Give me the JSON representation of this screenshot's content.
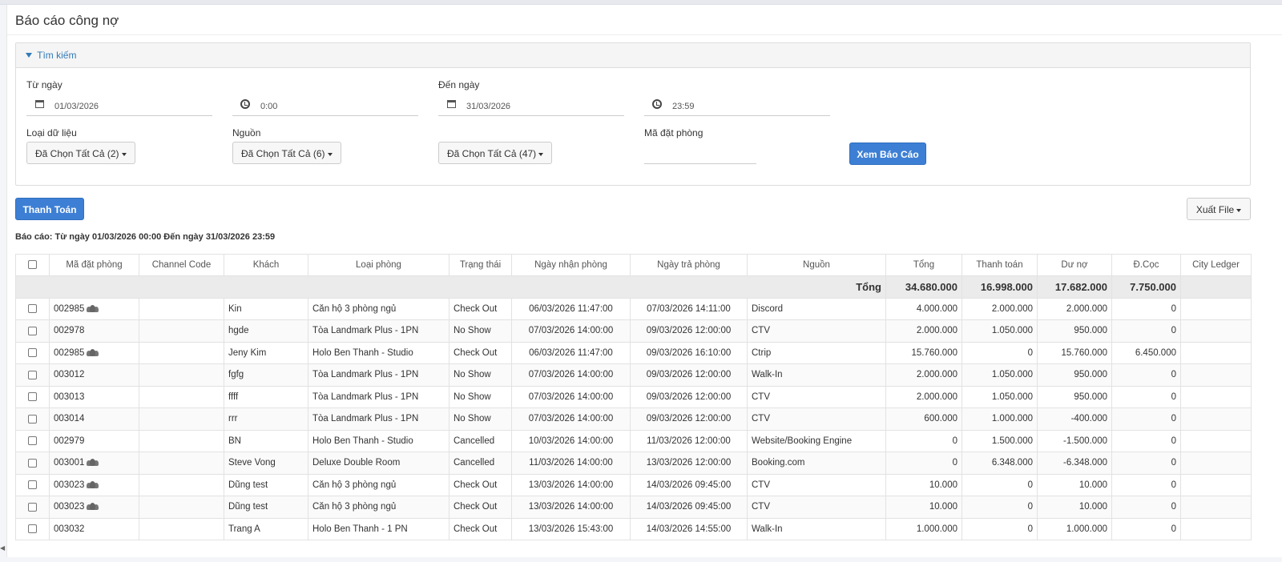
{
  "page": {
    "title": "Báo cáo công nợ"
  },
  "search": {
    "header": "Tìm kiếm",
    "from_label": "Từ ngày",
    "from_date": "01/03/2026",
    "from_time": "0:00",
    "to_label": "Đến ngày",
    "to_date": "31/03/2026",
    "to_time": "23:59",
    "data_type_label": "Loại dữ liệu",
    "data_type_value": "Đã Chọn Tất Cả (2)",
    "source_label": "Nguồn",
    "source_value": "Đã Chọn Tất Cả (6)",
    "third_value": "Đã Chọn Tất Cả (47)",
    "booking_code_label": "Mã đặt phòng",
    "booking_code_value": "",
    "view_button": "Xem Báo Cáo"
  },
  "toolbar": {
    "pay_button": "Thanh Toán",
    "export_button": "Xuất File"
  },
  "report_note": "Báo cáo: Từ ngày 01/03/2026 00:00 Đến ngày 31/03/2026 23:59",
  "table": {
    "headers": [
      "Mã đặt phòng",
      "Channel Code",
      "Khách",
      "Loại phòng",
      "Trạng thái",
      "Ngày nhận phòng",
      "Ngày trả phòng",
      "Nguồn",
      "Tổng",
      "Thanh toán",
      "Dư nợ",
      "Đ.Cọc",
      "City Ledger"
    ],
    "total": {
      "label": "Tổng",
      "tong": "34.680.000",
      "thanh_toan": "16.998.000",
      "du_no": "17.682.000",
      "coc": "7.750.000"
    },
    "rows": [
      {
        "code": "002985",
        "group": true,
        "channel": "",
        "guest": "Kin",
        "room": "Căn hộ 3 phòng ngủ",
        "status": "Check Out",
        "checkin": "06/03/2026 11:47:00",
        "checkout": "07/03/2026 14:11:00",
        "source": "Discord",
        "tong": "4.000.000",
        "paid": "2.000.000",
        "debt": "2.000.000",
        "deposit": "0",
        "ledger": ""
      },
      {
        "code": "002978",
        "group": false,
        "channel": "",
        "guest": "hgde",
        "room": "Tòa Landmark Plus - 1PN",
        "status": "No Show",
        "checkin": "07/03/2026 14:00:00",
        "checkout": "09/03/2026 12:00:00",
        "source": "CTV",
        "tong": "2.000.000",
        "paid": "1.050.000",
        "debt": "950.000",
        "deposit": "0",
        "ledger": ""
      },
      {
        "code": "002985",
        "group": true,
        "channel": "",
        "guest": "Jeny Kim",
        "room": "Holo Ben Thanh - Studio",
        "status": "Check Out",
        "checkin": "06/03/2026 11:47:00",
        "checkout": "09/03/2026 16:10:00",
        "source": "Ctrip",
        "tong": "15.760.000",
        "paid": "0",
        "debt": "15.760.000",
        "deposit": "6.450.000",
        "ledger": ""
      },
      {
        "code": "003012",
        "group": false,
        "channel": "",
        "guest": "fgfg",
        "room": "Tòa Landmark Plus - 1PN",
        "status": "No Show",
        "checkin": "07/03/2026 14:00:00",
        "checkout": "09/03/2026 12:00:00",
        "source": "Walk-In",
        "tong": "2.000.000",
        "paid": "1.050.000",
        "debt": "950.000",
        "deposit": "0",
        "ledger": ""
      },
      {
        "code": "003013",
        "group": false,
        "channel": "",
        "guest": "ffff",
        "room": "Tòa Landmark Plus - 1PN",
        "status": "No Show",
        "checkin": "07/03/2026 14:00:00",
        "checkout": "09/03/2026 12:00:00",
        "source": "CTV",
        "tong": "2.000.000",
        "paid": "1.050.000",
        "debt": "950.000",
        "deposit": "0",
        "ledger": ""
      },
      {
        "code": "003014",
        "group": false,
        "channel": "",
        "guest": "rrr",
        "room": "Tòa Landmark Plus - 1PN",
        "status": "No Show",
        "checkin": "07/03/2026 14:00:00",
        "checkout": "09/03/2026 12:00:00",
        "source": "CTV",
        "tong": "600.000",
        "paid": "1.000.000",
        "debt": "-400.000",
        "deposit": "0",
        "ledger": ""
      },
      {
        "code": "002979",
        "group": false,
        "channel": "",
        "guest": "BN",
        "room": "Holo Ben Thanh - Studio",
        "status": "Cancelled",
        "checkin": "10/03/2026 14:00:00",
        "checkout": "11/03/2026 12:00:00",
        "source": "Website/Booking Engine",
        "tong": "0",
        "paid": "1.500.000",
        "debt": "-1.500.000",
        "deposit": "0",
        "ledger": ""
      },
      {
        "code": "003001",
        "group": true,
        "channel": "",
        "guest": "Steve Vong",
        "room": "Deluxe Double Room",
        "status": "Cancelled",
        "checkin": "11/03/2026 14:00:00",
        "checkout": "13/03/2026 12:00:00",
        "source": "Booking.com",
        "tong": "0",
        "paid": "6.348.000",
        "debt": "-6.348.000",
        "deposit": "0",
        "ledger": ""
      },
      {
        "code": "003023",
        "group": true,
        "channel": "",
        "guest": "Dũng test",
        "room": "Căn hộ 3 phòng ngủ",
        "status": "Check Out",
        "checkin": "13/03/2026 14:00:00",
        "checkout": "14/03/2026 09:45:00",
        "source": "CTV",
        "tong": "10.000",
        "paid": "0",
        "debt": "10.000",
        "deposit": "0",
        "ledger": ""
      },
      {
        "code": "003023",
        "group": true,
        "channel": "",
        "guest": "Dũng test",
        "room": "Căn hộ 3 phòng ngủ",
        "status": "Check Out",
        "checkin": "13/03/2026 14:00:00",
        "checkout": "14/03/2026 09:45:00",
        "source": "CTV",
        "tong": "10.000",
        "paid": "0",
        "debt": "10.000",
        "deposit": "0",
        "ledger": ""
      },
      {
        "code": "003032",
        "group": false,
        "channel": "",
        "guest": "Trang A",
        "room": "Holo Ben Thanh - 1 PN",
        "status": "Check Out",
        "checkin": "13/03/2026 15:43:00",
        "checkout": "14/03/2026 14:55:00",
        "source": "Walk-In",
        "tong": "1.000.000",
        "paid": "0",
        "debt": "1.000.000",
        "deposit": "0",
        "ledger": ""
      }
    ]
  }
}
